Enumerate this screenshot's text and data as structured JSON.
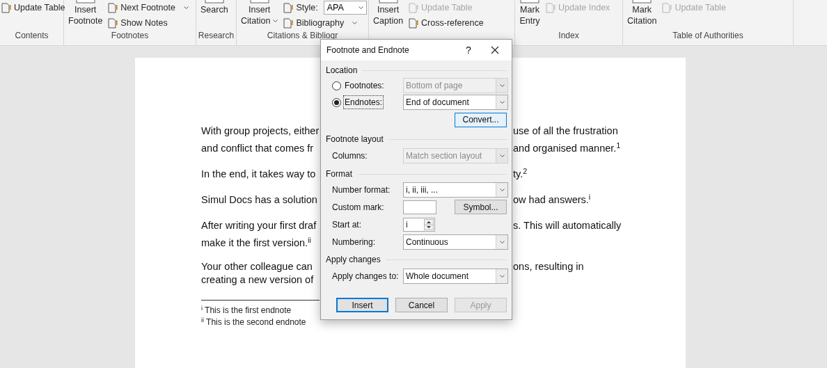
{
  "ribbon": {
    "groups": [
      {
        "label": "Contents",
        "controls": [
          {
            "kind": "small",
            "label": "Update Table",
            "disabled": false
          }
        ]
      },
      {
        "label": "Footnotes",
        "controls": [
          {
            "kind": "large",
            "lines": [
              "Insert",
              "Footnote"
            ]
          },
          {
            "kind": "small",
            "label": "Next Footnote",
            "disabled": false,
            "caret": true
          },
          {
            "kind": "small",
            "label": "Show Notes",
            "disabled": false
          }
        ]
      },
      {
        "label": "Research",
        "controls": [
          {
            "kind": "large",
            "lines": [
              "Search"
            ]
          }
        ]
      },
      {
        "label": "Citations & Bibliogr",
        "controls": [
          {
            "kind": "large",
            "lines": [
              "Insert",
              "Citation"
            ],
            "caret": true
          },
          {
            "kind": "small",
            "label": "Style:",
            "value": "APA",
            "disabled": false
          },
          {
            "kind": "small",
            "label": "Bibliography",
            "disabled": false,
            "caret": true
          }
        ]
      },
      {
        "controls": [
          {
            "kind": "large",
            "lines": [
              "Insert",
              "Caption"
            ]
          },
          {
            "kind": "small",
            "label": "Update Table",
            "disabled": true
          },
          {
            "kind": "small",
            "label": "Cross-reference",
            "disabled": false
          }
        ]
      },
      {
        "label": "Index",
        "controls": [
          {
            "kind": "large",
            "lines": [
              "Mark",
              "Entry"
            ]
          },
          {
            "kind": "small",
            "label": "Update Index",
            "disabled": true
          }
        ]
      },
      {
        "label": "Table of Authorities",
        "controls": [
          {
            "kind": "large",
            "lines": [
              "Mark",
              "Citation"
            ]
          },
          {
            "kind": "small",
            "label": "Update Table",
            "disabled": true
          }
        ]
      }
    ]
  },
  "document": {
    "paragraphs": [
      {
        "lines": [
          {
            "left": "With group projects, either",
            "right": "use of all the frustration"
          },
          {
            "left": "and conflict that comes fr",
            "right": "and organised manner.$^{1}$"
          }
        ]
      },
      {
        "lines": [
          {
            "left": "In the end, it takes way to",
            "right": "ty.$^{2}$"
          }
        ]
      },
      {
        "lines": [
          {
            "left": "Simul Docs has a solution",
            "right": "ow had answers.$^{i}$"
          }
        ]
      },
      {
        "lines": [
          {
            "left": "After writing your first draf",
            "right": "s. This will automatically"
          },
          {
            "left": "make it the first version.$^{ii}$"
          }
        ]
      },
      {
        "tight": true,
        "lines": [
          {
            "left": "Your other colleague can",
            "right": "ons, resulting in"
          },
          {
            "left": "creating a new version of"
          }
        ]
      }
    ],
    "endnotes": [
      "$^{i}$ This is the first endnote",
      "$^{ii}$ This is the second endnote"
    ]
  },
  "dialog": {
    "title": "Footnote and Endnote",
    "help": "?",
    "location": {
      "label": "Location",
      "options": [
        {
          "label": "Footnotes:",
          "selected": false,
          "focused": false,
          "value": "Bottom of page",
          "disabled": true
        },
        {
          "label": "Endnotes:",
          "selected": true,
          "focused": true,
          "value": "End of document",
          "disabled": false
        }
      ],
      "convert": {
        "label": "Convert...",
        "highlighted": true
      }
    },
    "layout": {
      "label": "Footnote layout",
      "columns": {
        "label": "Columns:",
        "value": "Match section layout",
        "disabled": true
      }
    },
    "format": {
      "label": "Format",
      "number_format": {
        "label": "Number format:",
        "value": "i, ii, iii, ..."
      },
      "custom_mark": {
        "label": "Custom mark:"
      },
      "symbol": "Symbol...",
      "start_at": {
        "label": "Start at:",
        "value": "i"
      },
      "numbering": {
        "label": "Numbering:",
        "value": "Continuous"
      }
    },
    "apply": {
      "label": "Apply changes",
      "apply_to": {
        "label": "Apply changes to:",
        "value": "Whole document"
      }
    },
    "buttons": [
      {
        "label": "Insert",
        "default": true,
        "disabled": false
      },
      {
        "label": "Cancel",
        "default": false,
        "disabled": false
      },
      {
        "label": "Apply",
        "default": false,
        "disabled": true
      }
    ]
  }
}
